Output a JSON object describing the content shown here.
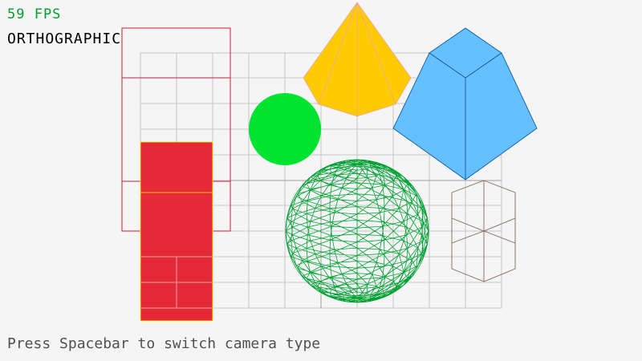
{
  "hud": {
    "fps_label": "59 FPS",
    "camera_mode": "ORTHOGRAPHIC",
    "instructions": "Press Spacebar to switch camera type"
  },
  "colors": {
    "background": "#f5f5f5",
    "fps_text": "#009e2f",
    "camera_text": "#000000",
    "instructions_text": "#505050",
    "grid": "#c8c8c8",
    "cube_wire": "#be2137",
    "cube_solid": "#e62937",
    "cube_solid_edge": "#fdf900",
    "sphere_solid": "#00e430",
    "sphere_wire": "#00a033",
    "pyramid": "#ffcb00",
    "pyramid_edge": "#e6a0b4",
    "prism": "#66bfff",
    "prism_edge": "#0050a0",
    "hex_wire": "#7f6a4f"
  },
  "scene_objects": [
    {
      "name": "cube-wireframe",
      "type": "wireframe cube"
    },
    {
      "name": "cube-solid",
      "type": "solid cube"
    },
    {
      "name": "sphere-solid",
      "type": "solid sphere"
    },
    {
      "name": "sphere-wireframe",
      "type": "wireframe sphere"
    },
    {
      "name": "cone-pyramid",
      "type": "solid cone"
    },
    {
      "name": "cylinder-prism",
      "type": "solid cylinder"
    },
    {
      "name": "cylinder-wireframe",
      "type": "wireframe cylinder"
    }
  ]
}
